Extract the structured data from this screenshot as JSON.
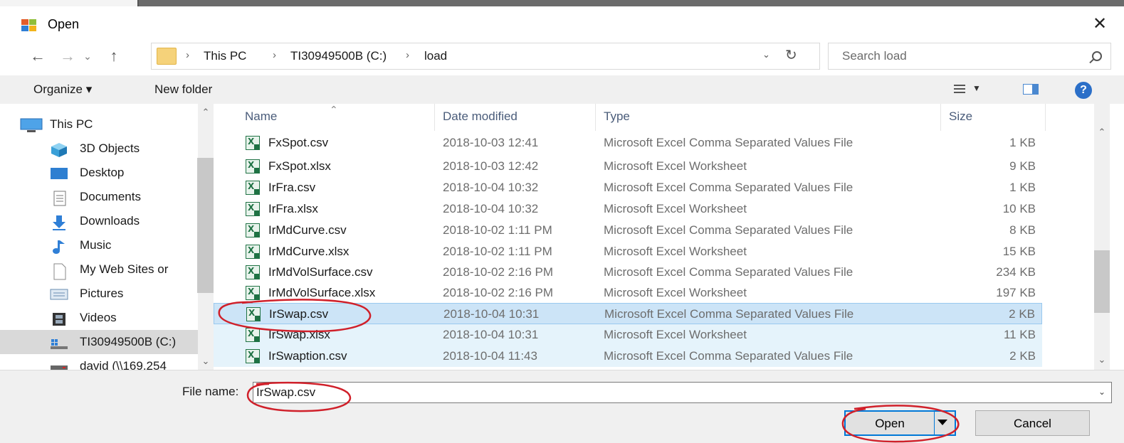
{
  "window": {
    "title": "Open",
    "close_glyph": "✕"
  },
  "address": {
    "crumbs": [
      "This PC",
      "TI30949500B (C:)",
      "load"
    ],
    "separator": "›"
  },
  "search": {
    "placeholder": "Search load"
  },
  "toolbar": {
    "organize": "Organize ▾",
    "new_folder": "New folder",
    "help": "?"
  },
  "nav": {
    "items": [
      {
        "label": "This PC",
        "icon": "computer-icon"
      },
      {
        "label": "3D Objects",
        "icon": "cube-3d-icon"
      },
      {
        "label": "Desktop",
        "icon": "desktop-icon"
      },
      {
        "label": "Documents",
        "icon": "documents-icon"
      },
      {
        "label": "Downloads",
        "icon": "download-arrow-icon"
      },
      {
        "label": "Music",
        "icon": "music-note-icon"
      },
      {
        "label": "My Web Sites or",
        "icon": "blank-page-icon"
      },
      {
        "label": "Pictures",
        "icon": "pictures-icon"
      },
      {
        "label": "Videos",
        "icon": "video-film-icon"
      },
      {
        "label": "TI30949500B (C:)",
        "icon": "drive-icon"
      },
      {
        "label": "david (\\\\169.254",
        "icon": "network-drive-icon"
      }
    ]
  },
  "columns": {
    "name": "Name",
    "date": "Date modified",
    "type": "Type",
    "size": "Size"
  },
  "files": [
    {
      "name": "FxSpot.csv",
      "date": "2018-10-03 12:41",
      "type": "Microsoft Excel Comma Separated Values File",
      "size": "1 KB"
    },
    {
      "name": "FxSpot.xlsx",
      "date": "2018-10-03 12:42",
      "type": "Microsoft Excel Worksheet",
      "size": "9 KB"
    },
    {
      "name": "IrFra.csv",
      "date": "2018-10-04 10:32",
      "type": "Microsoft Excel Comma Separated Values File",
      "size": "1 KB"
    },
    {
      "name": "IrFra.xlsx",
      "date": "2018-10-04 10:32",
      "type": "Microsoft Excel Worksheet",
      "size": "10 KB"
    },
    {
      "name": "IrMdCurve.csv",
      "date": "2018-10-02 1:11 PM",
      "type": "Microsoft Excel Comma Separated Values File",
      "size": "8 KB"
    },
    {
      "name": "IrMdCurve.xlsx",
      "date": "2018-10-02 1:11 PM",
      "type": "Microsoft Excel Worksheet",
      "size": "15 KB"
    },
    {
      "name": "IrMdVolSurface.csv",
      "date": "2018-10-02 2:16 PM",
      "type": "Microsoft Excel Comma Separated Values File",
      "size": "234 KB"
    },
    {
      "name": "IrMdVolSurface.xlsx",
      "date": "2018-10-02 2:16 PM",
      "type": "Microsoft Excel Worksheet",
      "size": "197 KB"
    },
    {
      "name": "IrSwap.csv",
      "date": "2018-10-04 10:31",
      "type": "Microsoft Excel Comma Separated Values File",
      "size": "2 KB"
    },
    {
      "name": "IrSwap.xlsx",
      "date": "2018-10-04 10:31",
      "type": "Microsoft Excel Worksheet",
      "size": "11 KB"
    },
    {
      "name": "IrSwaption.csv",
      "date": "2018-10-04 11:43",
      "type": "Microsoft Excel Comma Separated Values File",
      "size": "2 KB"
    }
  ],
  "filename": {
    "label": "File name:",
    "value": "IrSwap.csv"
  },
  "buttons": {
    "open": "Open",
    "cancel": "Cancel"
  },
  "colors": {
    "selection": "#cce4f7",
    "hover": "#e5f3fb",
    "accent": "#0078d7",
    "annotation": "#d0202a"
  }
}
